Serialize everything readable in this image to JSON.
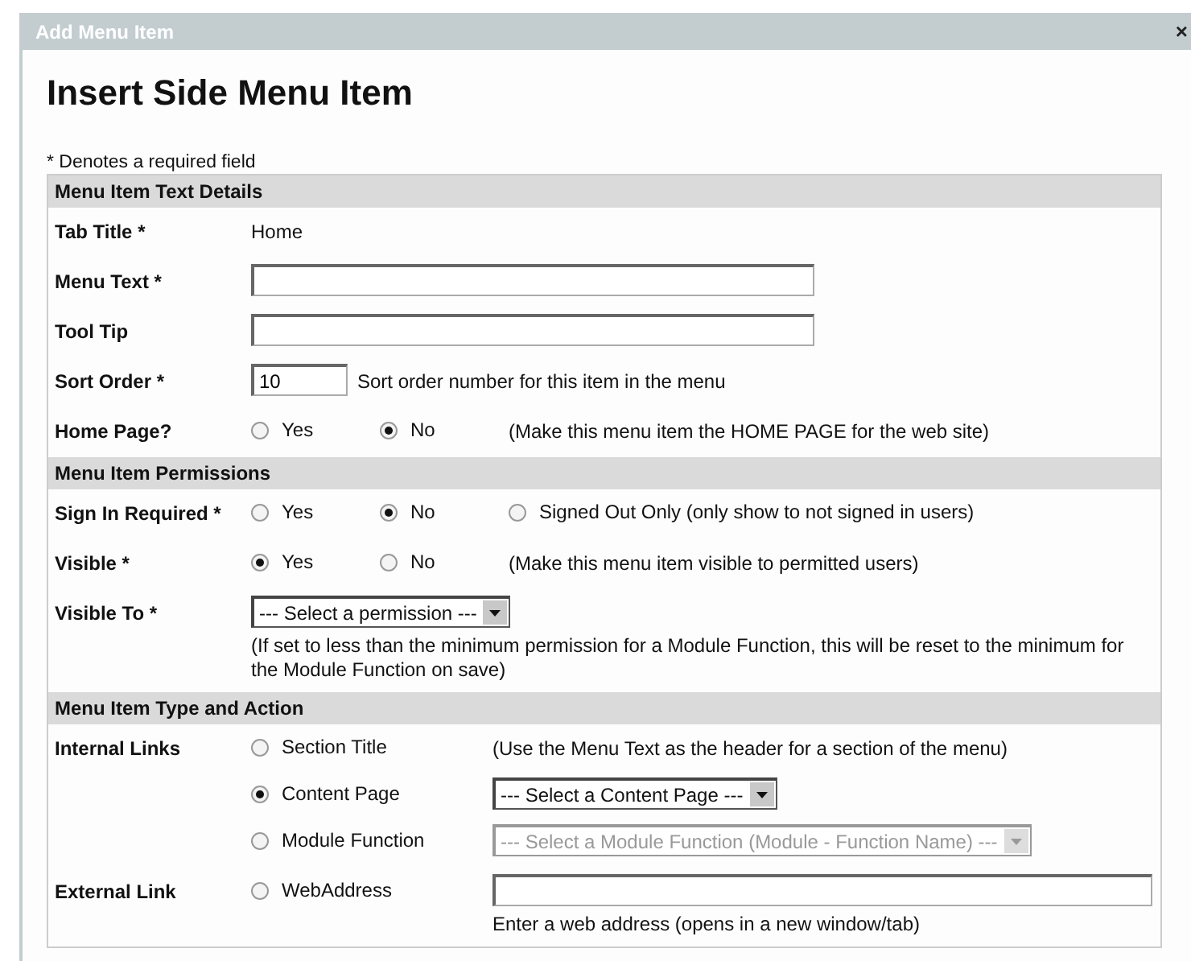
{
  "window": {
    "title": "Add Menu Item",
    "close": "×"
  },
  "heading": "Insert Side Menu Item",
  "required_note": "* Denotes a required field",
  "sections": [
    {
      "title": "Menu Item Text Details",
      "rows": [
        {
          "label": "Tab Title *",
          "lines": [
            [
              {
                "kind": "text",
                "text": "Home"
              }
            ]
          ]
        },
        {
          "label": "Menu Text *",
          "lines": [
            [
              {
                "kind": "input"
              }
            ]
          ]
        },
        {
          "label": "Tool Tip",
          "lines": [
            [
              {
                "kind": "input"
              }
            ]
          ]
        },
        {
          "label": "Sort Order *",
          "lines": [
            [
              {
                "kind": "number_input",
                "value": "10"
              },
              {
                "kind": "text",
                "text": "Sort order number for this item in the menu"
              }
            ]
          ]
        },
        {
          "label": "Home Page?",
          "lines": [
            [
              {
                "kind": "radio",
                "label": "Yes",
                "checked": false
              },
              {
                "kind": "radio",
                "label": "No",
                "checked": true
              },
              {
                "kind": "text",
                "text": "(Make this menu item the HOME PAGE for the web site)"
              }
            ]
          ]
        }
      ]
    },
    {
      "title": "Menu Item Permissions",
      "rows": [
        {
          "label": "Sign In Required *",
          "lines": [
            [
              {
                "kind": "radio",
                "label": "Yes",
                "checked": false
              },
              {
                "kind": "radio",
                "label": "No",
                "checked": true
              },
              {
                "kind": "radio",
                "label": "Signed Out Only (only show to not signed in users)",
                "checked": false
              }
            ]
          ]
        },
        {
          "label": "Visible *",
          "lines": [
            [
              {
                "kind": "radio",
                "label": "Yes",
                "checked": true
              },
              {
                "kind": "radio",
                "label": "No",
                "checked": false
              },
              {
                "kind": "text",
                "text": "(Make this menu item visible to permitted users)"
              }
            ]
          ]
        },
        {
          "label": "Visible To *",
          "lines": [
            [
              {
                "kind": "select",
                "value": "--- Select a permission ---",
                "disabled": false,
                "note": "(If set to less than the minimum permission for a Module Function, this will be reset to the minimum for the Module Function on save)"
              }
            ]
          ]
        }
      ]
    },
    {
      "title": "Menu Item Type and Action",
      "rows": [
        {
          "label": "Internal Links",
          "lines": [
            [
              {
                "kind": "radio",
                "label": "Section Title",
                "checked": false
              },
              {
                "kind": "text",
                "text": "(Use the Menu Text as the header for a section of the menu)"
              }
            ],
            [
              {
                "kind": "radio",
                "label": "Content Page",
                "checked": true
              },
              {
                "kind": "select",
                "value": "--- Select a Content Page ---",
                "disabled": false
              }
            ],
            [
              {
                "kind": "radio",
                "label": "Module Function",
                "checked": false
              },
              {
                "kind": "select",
                "value": "--- Select a Module Function (Module - Function Name) ---",
                "disabled": true
              }
            ]
          ]
        },
        {
          "label": "External Link",
          "lines": [
            [
              {
                "kind": "radio",
                "label": "WebAddress",
                "checked": false
              },
              {
                "kind": "url_input",
                "note": "Enter a web address (opens in a new window/tab)"
              }
            ]
          ]
        }
      ]
    }
  ]
}
